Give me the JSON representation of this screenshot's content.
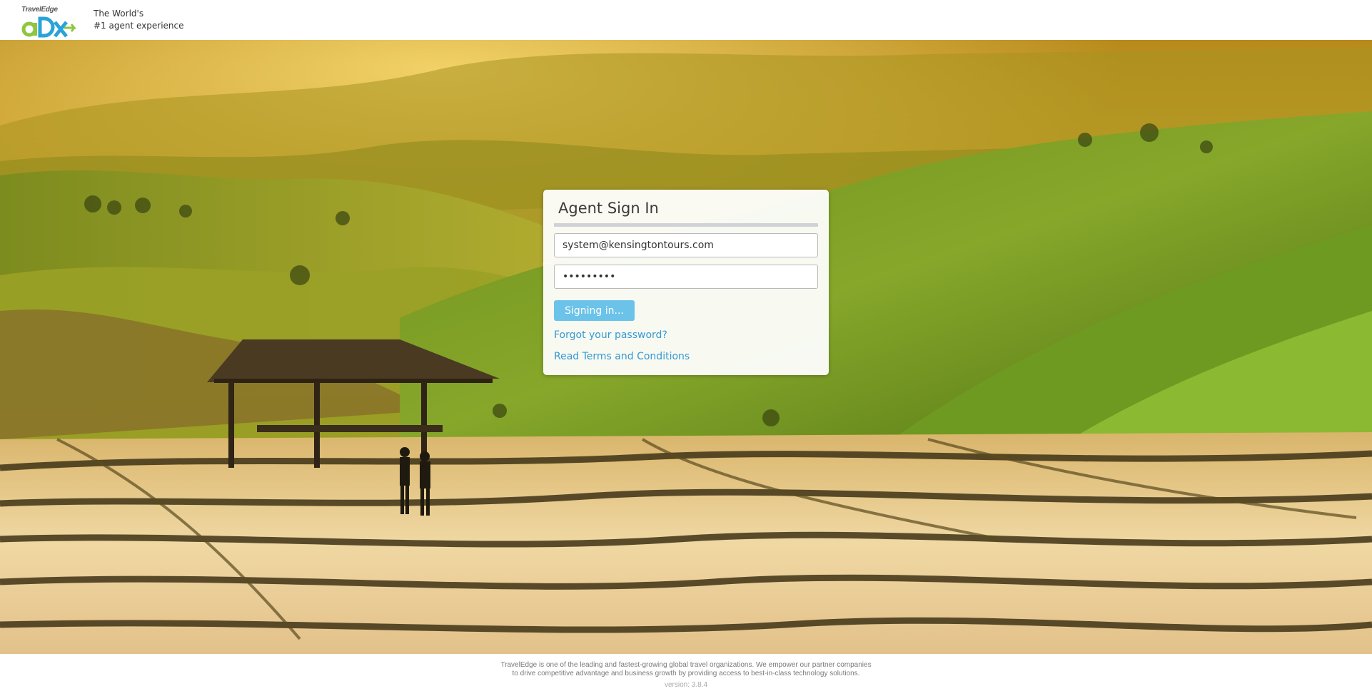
{
  "header": {
    "logo_brand": "TravelEdge",
    "logo_mark": "ADX",
    "tagline_line1": "The World's",
    "tagline_line2": "#1 agent experience"
  },
  "login": {
    "title": "Agent Sign In",
    "email_value": "system@kensingtontours.com",
    "password_value": "•••••••••",
    "signin_label": "Signing in...",
    "forgot_link": "Forgot your password?",
    "terms_link": "Read Terms and Conditions"
  },
  "footer": {
    "line1": "TravelEdge is one of the leading and fastest-growing global travel organizations. We empower our partner companies",
    "line2": "to drive competitive advantage and business growth by providing access to best-in-class technology solutions.",
    "version": "version: 3.8.4"
  },
  "colors": {
    "brand_green": "#8dc63f",
    "brand_blue": "#29a3d9",
    "button": "#6bc3e9",
    "link": "#3598d4"
  }
}
